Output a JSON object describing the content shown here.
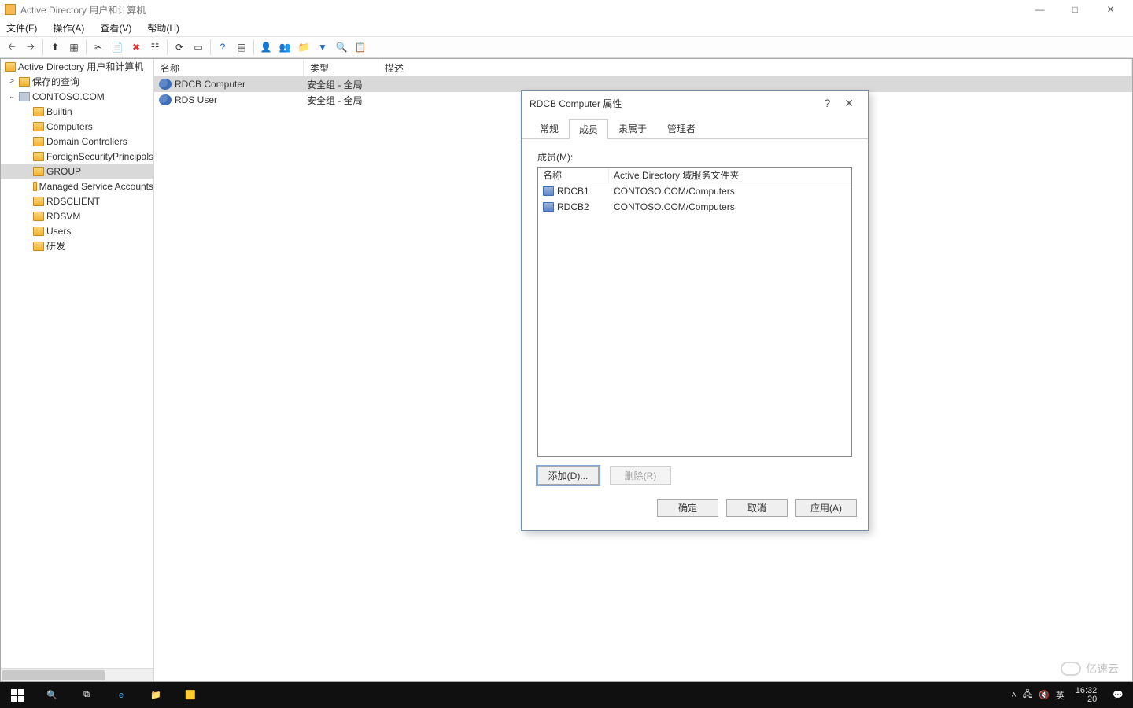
{
  "window": {
    "title": "Active Directory 用户和计算机"
  },
  "menu": {
    "file": "文件(F)",
    "action": "操作(A)",
    "view": "查看(V)",
    "help": "帮助(H)"
  },
  "tree": {
    "root": "Active Directory 用户和计算机",
    "saved": "保存的查询",
    "domain": "CONTOSO.COM",
    "items": [
      {
        "label": "Builtin"
      },
      {
        "label": "Computers"
      },
      {
        "label": "Domain Controllers"
      },
      {
        "label": "ForeignSecurityPrincipals"
      },
      {
        "label": "GROUP",
        "selected": true
      },
      {
        "label": "Managed Service Accounts"
      },
      {
        "label": "RDSCLIENT"
      },
      {
        "label": "RDSVM"
      },
      {
        "label": "Users"
      },
      {
        "label": "研发"
      }
    ]
  },
  "list": {
    "headers": {
      "name": "名称",
      "type": "类型",
      "desc": "描述"
    },
    "rows": [
      {
        "name": "RDCB Computer",
        "type": "安全组 - 全局",
        "selected": true
      },
      {
        "name": "RDS User",
        "type": "安全组 - 全局"
      }
    ]
  },
  "dialog": {
    "title": "RDCB Computer 属性",
    "tabs": {
      "general": "常规",
      "members": "成员",
      "memberof": "隶属于",
      "managed": "管理者"
    },
    "members_label": "成员(M):",
    "members_headers": {
      "name": "名称",
      "folder": "Active Directory 域服务文件夹"
    },
    "members": [
      {
        "name": "RDCB1",
        "folder": "CONTOSO.COM/Computers"
      },
      {
        "name": "RDCB2",
        "folder": "CONTOSO.COM/Computers"
      }
    ],
    "buttons": {
      "add": "添加(D)...",
      "remove": "删除(R)",
      "ok": "确定",
      "cancel": "取消",
      "apply": "应用(A)"
    }
  },
  "taskbar": {
    "ime": "英",
    "year": "20",
    "time": "16:32"
  },
  "watermark": "亿速云"
}
